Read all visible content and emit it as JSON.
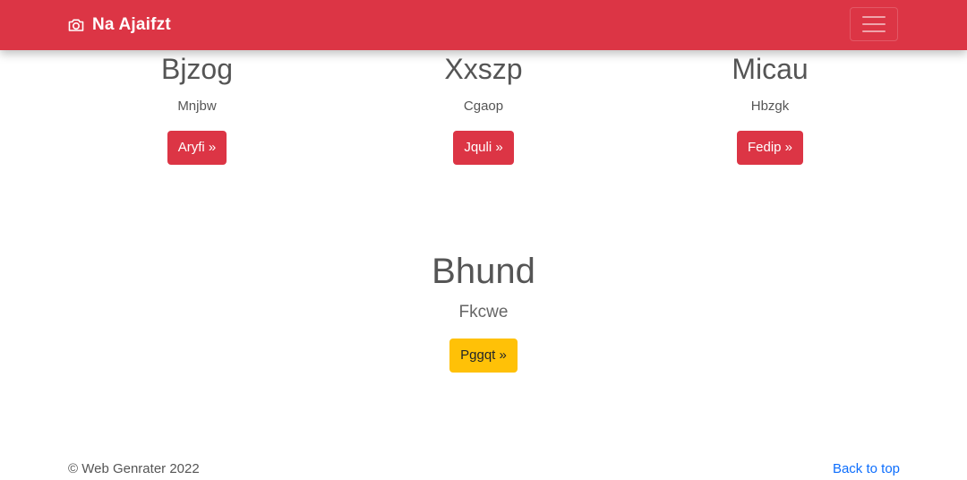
{
  "navbar": {
    "brand": "Na Ajaifzt",
    "brand_icon": "camera-icon",
    "toggler_icon": "hamburger-icon",
    "color": "#dc3545"
  },
  "features": [
    {
      "title": "Bjzog",
      "text": "Mnjbw",
      "button": "Aryfi »"
    },
    {
      "title": "Xxszp",
      "text": "Cgaop",
      "button": "Jquli »"
    },
    {
      "title": "Micau",
      "text": "Hbzgk",
      "button": "Fedip »"
    }
  ],
  "highlight": {
    "title": "Bhund",
    "text": "Fkcwe",
    "button": "Pggqt »",
    "button_color": "#ffc107"
  },
  "footer": {
    "copyright": "© Web Genrater 2022",
    "back_to_top": "Back to top"
  }
}
